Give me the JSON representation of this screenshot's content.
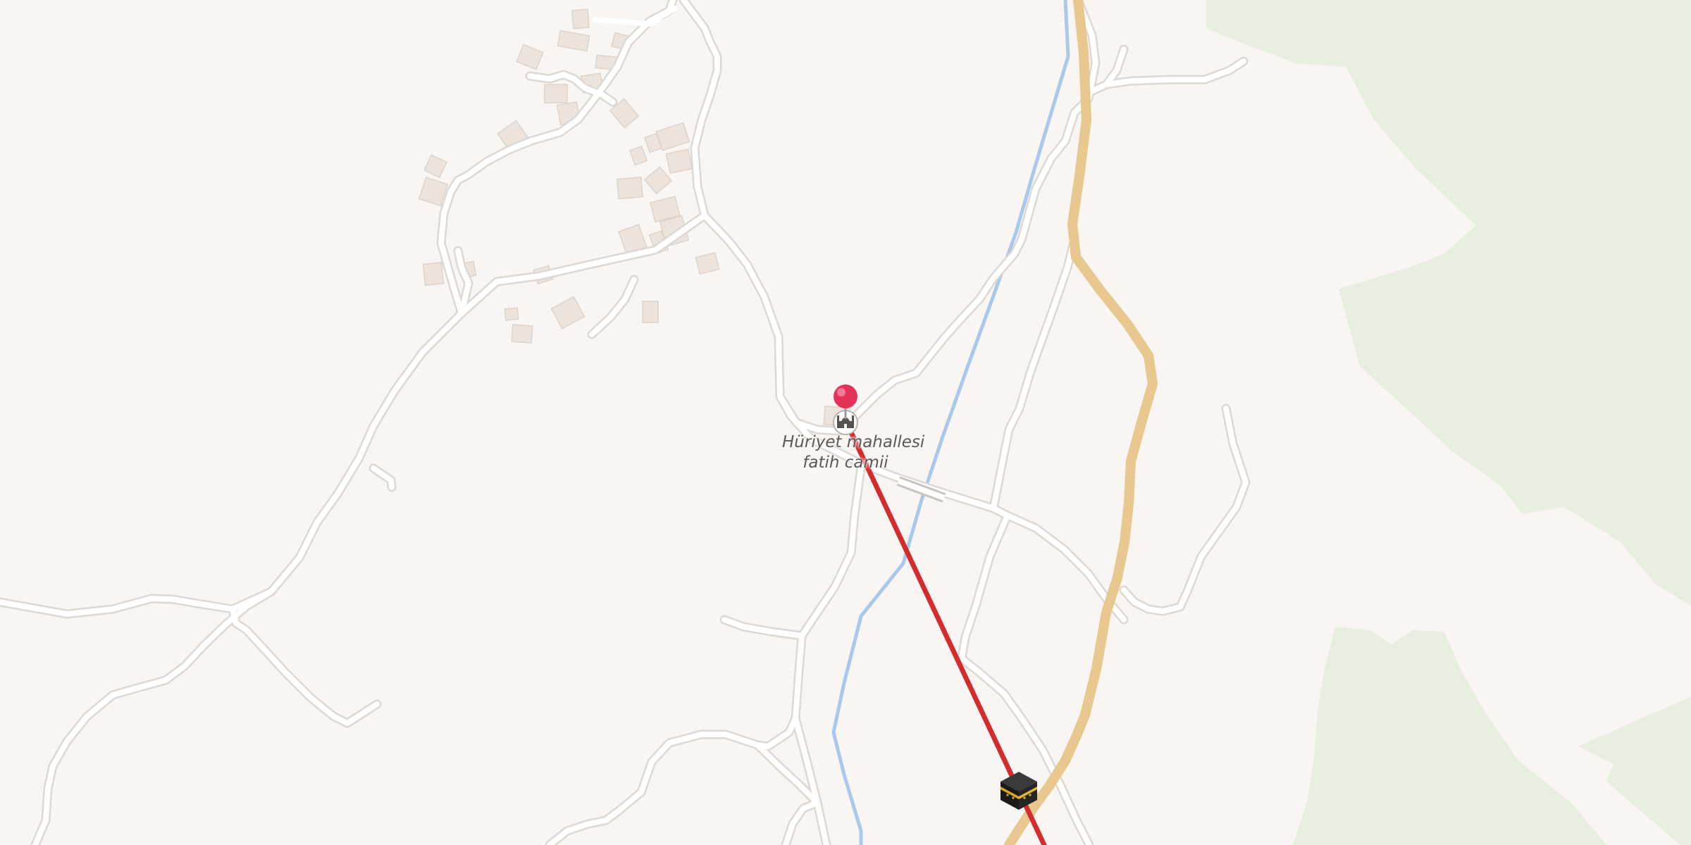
{
  "map": {
    "poi": {
      "name_line1": "Hüriyet mahallesi",
      "name_line2": "fatih camii",
      "icon": "mosque-icon"
    },
    "marker": {
      "icon": "map-pin-icon",
      "color": "#e2325a"
    },
    "qibla": {
      "icon": "kaaba-icon",
      "line_color": "#d42c2c"
    },
    "colors": {
      "background": "#f8f5f2",
      "forest": "#e8eee0",
      "road": "#ffffff",
      "road_casing": "#dcd8d4",
      "main_road": "#fde2a4",
      "main_road_casing": "#e8c88e",
      "river": "#a8c8ec",
      "building": "#ece4dc"
    }
  }
}
